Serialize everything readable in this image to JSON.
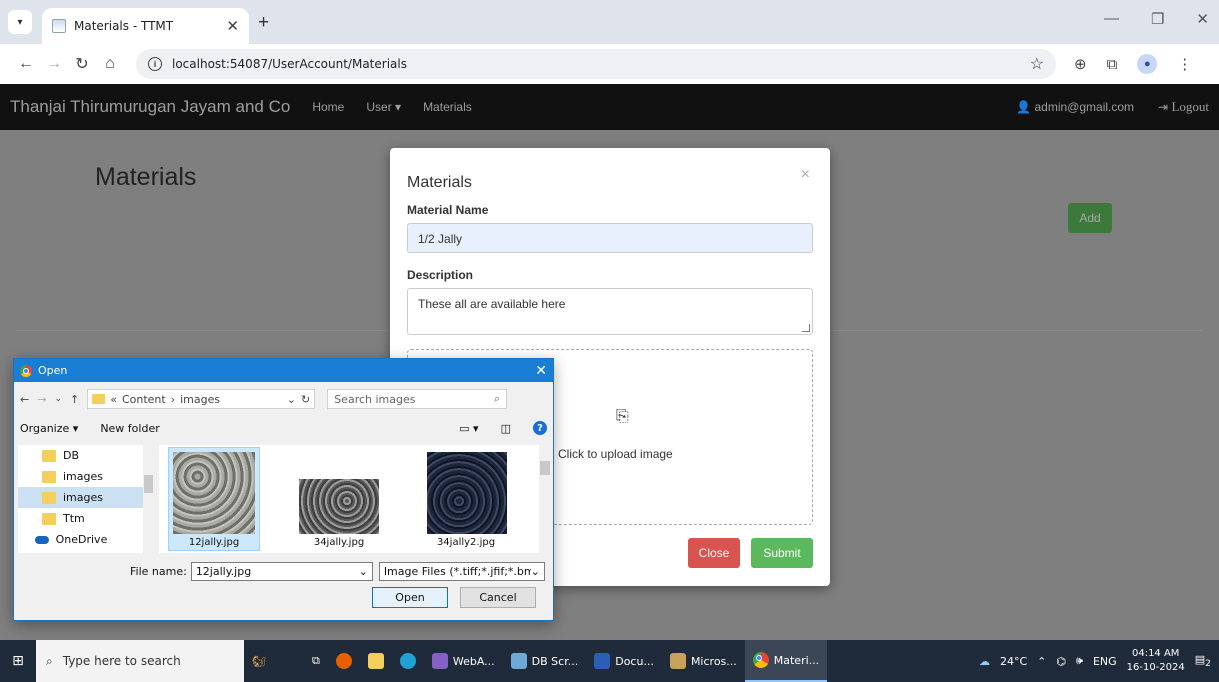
{
  "browser": {
    "tab_title": "Materials - TTMT",
    "url": "localhost:54087/UserAccount/Materials"
  },
  "navbar": {
    "brand": "Thanjai Thirumurugan Jayam and Co",
    "links": [
      "Home",
      "User",
      "Materials"
    ],
    "user_email": "admin@gmail.com",
    "logout": "Logout"
  },
  "page": {
    "title": "Materials",
    "add_button": "Add"
  },
  "modal": {
    "title": "Materials",
    "name_label": "Material Name",
    "name_value": "1/2 Jally",
    "description_label": "Description",
    "description_value": "These all are available here",
    "upload_text": "Click to upload image",
    "close_button": "Close",
    "submit_button": "Submit"
  },
  "open_dialog": {
    "title": "Open",
    "path_prefix": "«",
    "path_parts": [
      "Content",
      "images"
    ],
    "search_placeholder": "Search images",
    "organize": "Organize ▾",
    "new_folder": "New folder",
    "tree": [
      "DB",
      "images",
      "images",
      "Ttm",
      "OneDrive"
    ],
    "tree_selected": 2,
    "files": [
      "12jally.jpg",
      "34jally.jpg",
      "34jally2.jpg"
    ],
    "file_selected": 0,
    "file_name_label": "File name:",
    "file_name_value": "12jally.jpg",
    "filter": "Image Files (*.tiff;*.jfif;*.bmp;*.g",
    "open_button": "Open",
    "cancel_button": "Cancel"
  },
  "taskbar": {
    "search_placeholder": "Type here to search",
    "apps": [
      "WebA...",
      "DB Scr...",
      "Docu...",
      "Micros...",
      "Materi..."
    ],
    "weather": "24°C",
    "language": "ENG",
    "time": "04:14 AM",
    "date": "16-10-2024",
    "notification_count": "2"
  },
  "colors": {
    "navbar_bg": "#111111",
    "add_green": "#3c7a3b",
    "close_red": "#d9534f",
    "submit_green": "#5cb85c",
    "dialog_titlebar": "#1a7fd4"
  }
}
